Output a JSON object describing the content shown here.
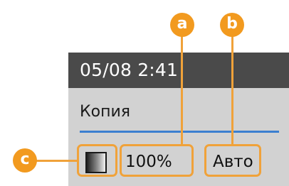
{
  "status_bar": {
    "time": "05/08 2:41"
  },
  "screen": {
    "mode_title": "Копия",
    "density_icon": "density-gradient-icon",
    "zoom_value": "100%",
    "paper_value": "Авто"
  },
  "callouts": {
    "a": "a",
    "b": "b",
    "c": "c"
  },
  "colors": {
    "accent_orange": "#f29a1f",
    "divider_blue": "#3b7fd0",
    "status_bar_bg": "#4a4a4a",
    "panel_bg": "#d2d2d2"
  }
}
